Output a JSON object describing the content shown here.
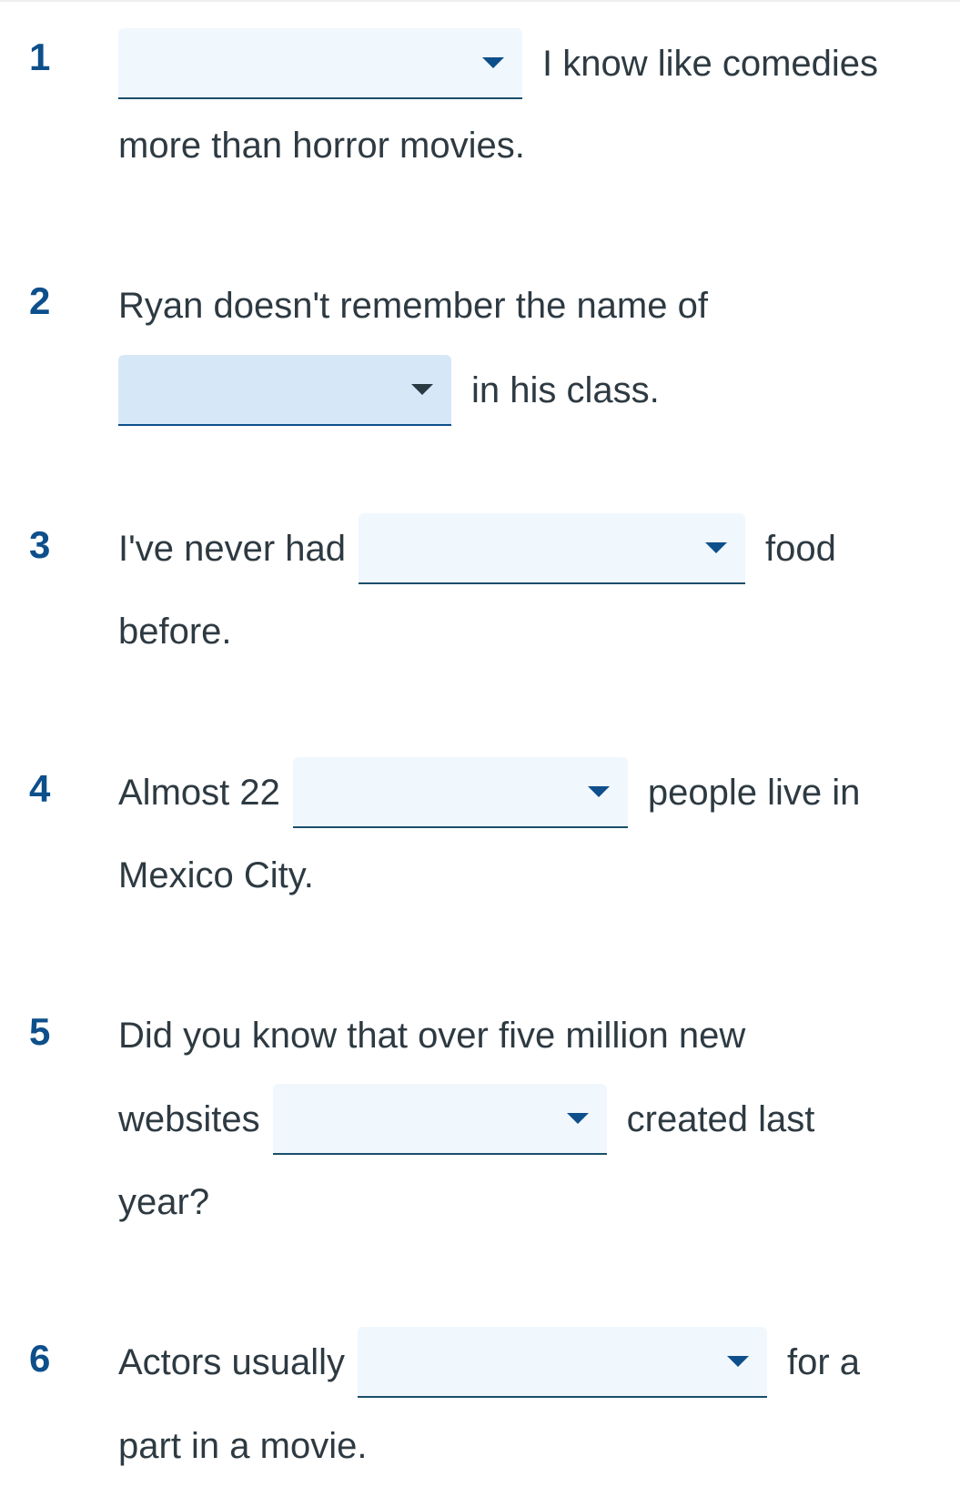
{
  "items": [
    {
      "number": "1",
      "after": "I know like comedies",
      "line2": "more than horror movies."
    },
    {
      "number": "2",
      "before": "Ryan doesn't remember the name of",
      "after": "in his class."
    },
    {
      "number": "3",
      "before": "I've never had",
      "after": "food",
      "line2": "before."
    },
    {
      "number": "4",
      "before": "Almost 22",
      "after": "people live in",
      "line2": "Mexico City."
    },
    {
      "number": "5",
      "before": "Did you know that over five million new",
      "mid_before": "websites",
      "after": "created last",
      "line3": "year?"
    },
    {
      "number": "6",
      "before": "Actors usually",
      "after": "for a",
      "line2": "part in a movie."
    }
  ],
  "colors": {
    "accent": "#0d4f8b",
    "dropdown_bg": "#f0f7fd",
    "dropdown_active_bg": "#d6e8f8",
    "text": "#2e3a42"
  }
}
